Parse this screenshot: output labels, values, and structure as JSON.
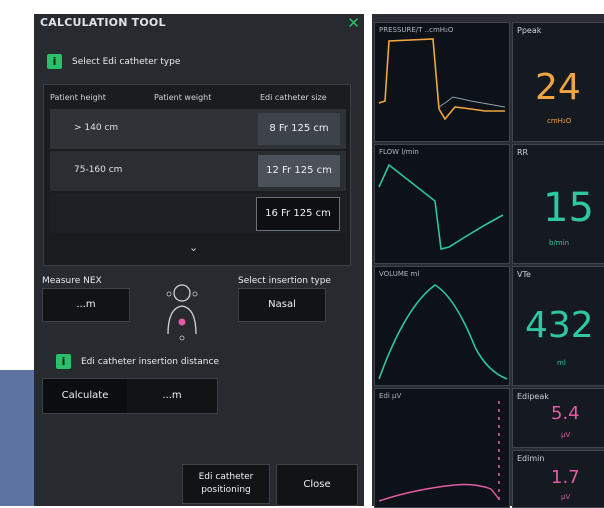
{
  "dialog": {
    "title": "CALCULATION TOOL",
    "close_icon": "close-x-icon",
    "select_catheter_label": "Select Edi catheter type",
    "table": {
      "headers": [
        "Patient height",
        "Patient weight",
        "Edi catheter size"
      ],
      "rows": [
        {
          "height": "> 140 cm",
          "size": "8 Fr 125 cm"
        },
        {
          "height": "75-160 cm",
          "size": "12 Fr 125 cm"
        },
        {
          "height": "",
          "size": "16 Fr 125 cm"
        }
      ]
    },
    "measure_nex_label": "Measure NEX",
    "measure_nex_value": "...m",
    "select_insertion_label": "Select insertion type",
    "insertion_value": "Nasal",
    "insertion_distance_label": "Edi catheter insertion distance",
    "calculate_label": "Calculate",
    "calculate_value": "...m",
    "positioning_label_line1": "Edi catheter",
    "positioning_label_line2": "positioning",
    "close_label": "Close"
  },
  "waveforms": [
    {
      "label": "PRESSURE/T ..cmH₂O",
      "color": "#f0a640"
    },
    {
      "label": "FLOW l/min",
      "color": "#2ec7a0"
    },
    {
      "label": "VOLUME ml",
      "color": "#2ec7a0"
    },
    {
      "label": "Edi µV",
      "color": "#e45ca5"
    }
  ],
  "params": {
    "ppeak": {
      "label": "Ppeak",
      "value": "24",
      "unit": "cmH₂O",
      "color": "#f0a640"
    },
    "rr": {
      "label": "RR",
      "value": "15",
      "unit": "b/min",
      "color": "#2ec7a0"
    },
    "vte": {
      "label": "VTe",
      "value": "432",
      "unit": "ml",
      "color": "#2ec7a0"
    },
    "edipeak": {
      "label": "Edipeak",
      "value": "5.4",
      "unit": "µV",
      "color": "#e45ca5"
    },
    "edimin": {
      "label": "Edimin",
      "value": "1.7",
      "unit": "µV",
      "color": "#e45ca5"
    }
  }
}
